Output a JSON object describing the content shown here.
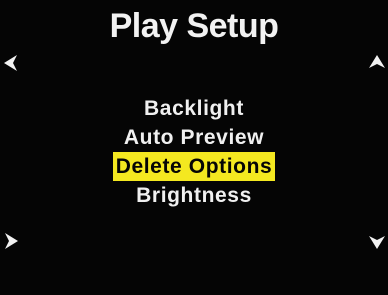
{
  "screen": {
    "title": "Play Setup",
    "background_color": "#050505",
    "text_color": "#f0f0f0",
    "highlight_color": "#f4e820"
  },
  "menu": {
    "items": [
      {
        "label": "Backlight",
        "selected": false
      },
      {
        "label": "Auto Preview",
        "selected": false
      },
      {
        "label": "Delete Options",
        "selected": true
      },
      {
        "label": "Brightness",
        "selected": false
      }
    ]
  },
  "navigation": {
    "left_icon": "chevron-left-icon",
    "right_icon": "chevron-right-icon",
    "up_icon": "chevron-up-icon",
    "down_icon": "chevron-down-icon"
  }
}
